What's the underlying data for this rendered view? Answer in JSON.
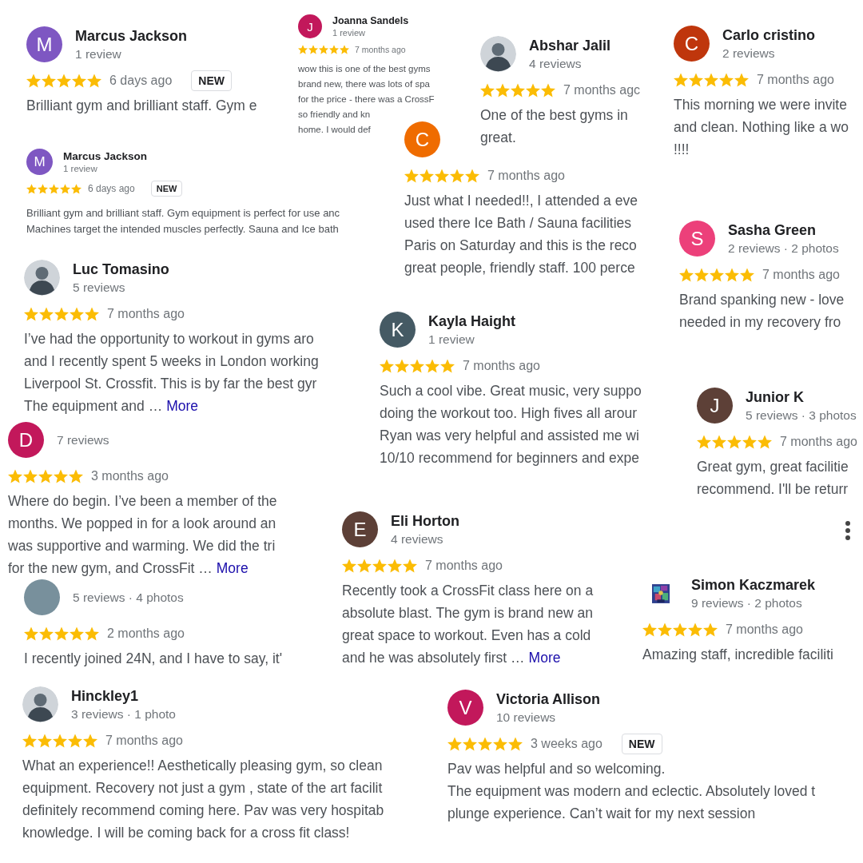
{
  "cards": [
    {
      "name": "Marcus Jackson",
      "initial": "M",
      "kind": "letter",
      "color": "#7e57c2",
      "meta": "1 review",
      "stars": 5,
      "time": "6 days ago",
      "badge": "NEW",
      "lines": [
        "Brilliant gym and brilliant staff. Gym e"
      ]
    },
    {
      "name": "Joanna Sandels",
      "initial": "J",
      "kind": "letter",
      "color": "#c2185b",
      "meta": "1 review",
      "stars": 5,
      "time": "7 months ago",
      "lines": [
        "wow this is one of the best gyms",
        "brand new, there was lots of spa",
        "for the price - there was a CrossF",
        "so friendly and kn",
        "home. I would def"
      ]
    },
    {
      "name": "Marcus Jackson",
      "initial": "M",
      "kind": "letter",
      "color": "#7e57c2",
      "meta": "1 review",
      "stars": 5,
      "time": "6 days ago",
      "badge": "NEW",
      "lines": [
        "Brilliant gym and brilliant staff. Gym equipment is perfect for use anc",
        "Machines target the intended muscles perfectly. Sauna and Ice bath"
      ]
    },
    {
      "name": "Abshar Jalil",
      "meta": "4 reviews",
      "stars": 5,
      "time": "7 months agc",
      "lines": [
        "One of the best gyms in",
        "great."
      ]
    },
    {
      "name": "Carlo cristino",
      "initial": "C",
      "kind": "letter",
      "color": "#bf360c",
      "meta": "2 reviews",
      "stars": 5,
      "time": "7 months ago",
      "lines": [
        "This morning we were invite",
        "and clean. Nothing like a wo",
        "!!!!"
      ]
    },
    {
      "initial": "C",
      "kind": "letter",
      "color": "#ef6c00",
      "stars": 5,
      "time": "7 months ago",
      "lines": [
        "Just what I needed!!, I attended a eve",
        "used there Ice Bath / Sauna facilities",
        "Paris on Saturday and this is the reco",
        "great people, friendly staff. 100 perce"
      ]
    },
    {
      "name": "Sasha Green",
      "initial": "S",
      "kind": "letter",
      "color": "#ec407a",
      "meta": "2 reviews · 2 photos",
      "stars": 5,
      "time": "7 months ago",
      "lines": [
        "Brand spanking new - love",
        "needed in my recovery fro"
      ]
    },
    {
      "name": "Luc Tomasino",
      "meta": "5 reviews",
      "stars": 5,
      "time": "7 months ago",
      "lines": [
        "I’ve had the opportunity to workout in gyms aro",
        "and I recently spent 5 weeks in London working",
        "Liverpool St. Crossfit. This is by far the best gyr",
        "The equipment and …"
      ],
      "more": "More"
    },
    {
      "name": "Kayla Haight",
      "initial": "K",
      "kind": "letter",
      "color": "#455a64",
      "meta": "1 review",
      "stars": 5,
      "time": "7 months ago",
      "lines": [
        "Such a cool vibe. Great music, very suppo",
        "doing the workout too. High fives all arour",
        "Ryan was very helpful and assisted me wi",
        "10/10 recommend for beginners and expe"
      ]
    },
    {
      "name": "Junior K",
      "initial": "J",
      "kind": "letter",
      "color": "#5d4037",
      "meta": "5 reviews · 3 photos",
      "stars": 5,
      "time": "7 months ago",
      "lines": [
        "Great gym, great facilitie",
        "recommend. I'll be returr"
      ]
    },
    {
      "initial": "D",
      "kind": "letter",
      "color": "#c2185b",
      "meta": "7 reviews",
      "stars": 5,
      "time": "3 months ago",
      "lines": [
        "Where do begin. I’ve been a member of the",
        "months. We popped in for a look around an",
        "was supportive and warming. We did the tri",
        "for the new gym, and CrossFit …"
      ],
      "more": "More"
    },
    {
      "kind": "letter",
      "color": "#78909c",
      "meta": "5 reviews · 4 photos",
      "stars": 5,
      "time": "2 months ago",
      "lines": [
        "I recently joined 24N, and I have to say, it'"
      ]
    },
    {
      "name": "Eli Horton",
      "initial": "E",
      "kind": "letter",
      "color": "#5d4037",
      "meta": "4 reviews",
      "stars": 5,
      "time": "7 months ago",
      "lines": [
        "Recently took a CrossFit class here on a",
        "absolute blast. The gym is brand new an",
        "great space to workout. Even has a cold",
        "and he was absolutely first …"
      ],
      "more": "More"
    },
    {
      "name": "Simon Kaczmarek",
      "kind": "picture",
      "meta": "9 reviews · 2 photos",
      "stars": 5,
      "time": "7 months ago",
      "lines": [
        "Amazing staff, incredible faciliti"
      ]
    },
    {
      "name": "Hinckley1",
      "meta": "3 reviews · 1 photo",
      "stars": 5,
      "time": "7 months ago",
      "lines": [
        "What an experience!! Aesthetically pleasing gym, so clean",
        "equipment. Recovery not just a gym , state of the art facilit",
        "definitely recommend coming here. Pav was very hospitab",
        "knowledge. I will be coming back for a cross fit class!"
      ]
    },
    {
      "name": "Victoria Allison",
      "initial": "V",
      "kind": "letter",
      "color": "#c2185b",
      "meta": "10 reviews",
      "stars": 5,
      "time": "3 weeks ago",
      "badge": "NEW",
      "lines": [
        "Pav was helpful and so welcoming.",
        "The equipment was modern and eclectic. Absolutely loved t",
        "plunge experience. Can’t wait for my next session"
      ]
    }
  ]
}
